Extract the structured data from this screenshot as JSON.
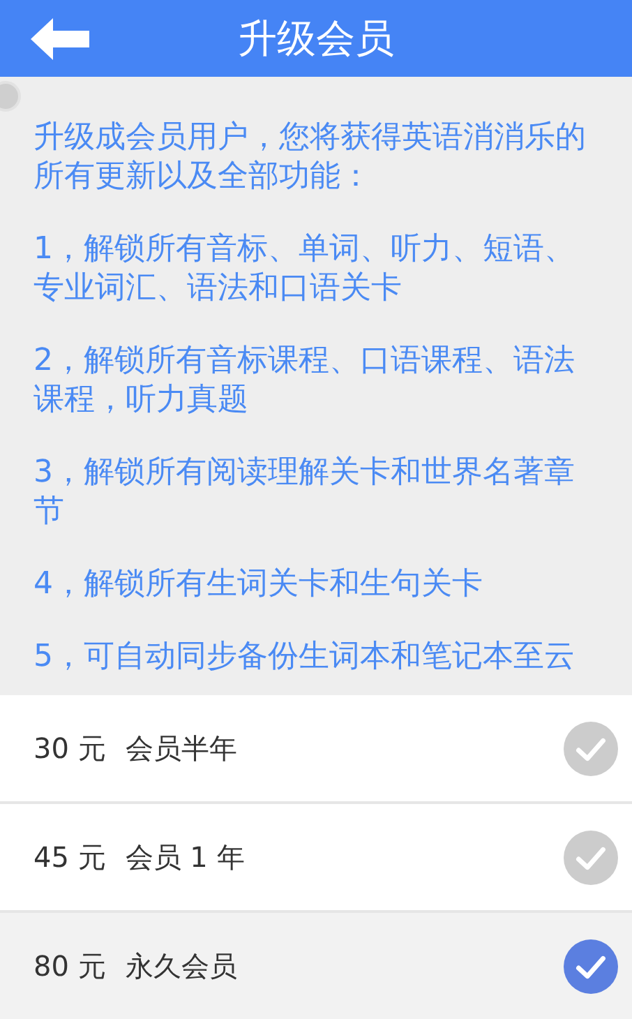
{
  "header": {
    "title": "升级会员"
  },
  "content": {
    "paragraphs": [
      "升级成会员用户，您将获得英语消消乐的所有更新以及全部功能：",
      "1，解锁所有音标、单词、听力、短语、专业词汇、语法和口语关卡",
      "2，解锁所有音标课程、口语课程、语法课程，听力真题",
      "3，解锁所有阅读理解关卡和世界名著章节",
      "4，解锁所有生词关卡和生句关卡",
      "5，可自动同步备份生词本和笔记本至云"
    ]
  },
  "plans": [
    {
      "price": "30 元",
      "name": "会员半年",
      "selected": false
    },
    {
      "price": "45 元",
      "name": "会员 1 年",
      "selected": false
    },
    {
      "price": "80 元",
      "name": "永久会员",
      "selected": true
    }
  ]
}
